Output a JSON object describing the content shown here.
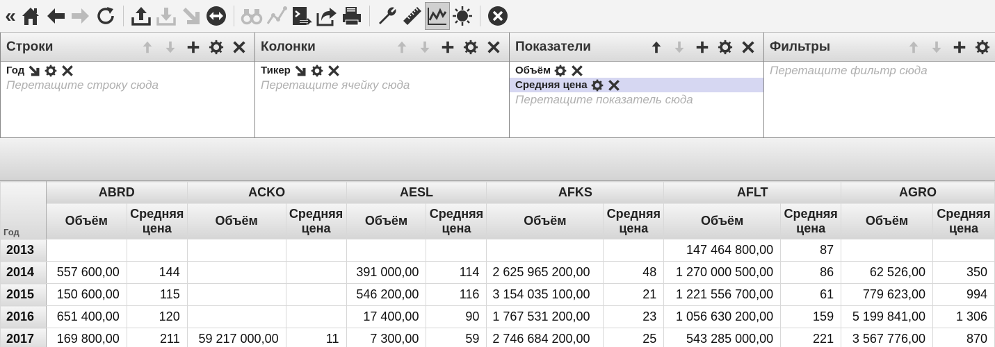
{
  "toolbar": {
    "collapse_glyph": "«",
    "icons": [
      "home-icon",
      "back-arrow-icon",
      "forward-arrow-icon",
      "refresh-icon",
      "upload-icon",
      "download-icon",
      "arrow-down-right-icon",
      "swap-icon",
      "binoculars-icon",
      "line-chart-icon",
      "export-image-icon",
      "share-icon",
      "print-icon",
      "wrench-icon",
      "ruler-icon",
      "chart-area-icon",
      "sun-icon",
      "close-circle-icon"
    ]
  },
  "panels": {
    "rows": {
      "title": "Строки",
      "chips": [
        {
          "label": "Год"
        }
      ],
      "hint": "Перетащите строку сюда"
    },
    "columns": {
      "title": "Колонки",
      "chips": [
        {
          "label": "Тикер"
        }
      ],
      "hint": "Перетащите ячейку сюда"
    },
    "measures": {
      "title": "Показатели",
      "chips": [
        {
          "label": "Объём"
        },
        {
          "label": "Средняя цена",
          "selected": true
        }
      ],
      "hint": "Перетащите показатель сюда"
    },
    "filters": {
      "title": "Фильтры",
      "hint": "Перетащите фильтр сюда"
    }
  },
  "grid": {
    "corner_label": "Год",
    "tickers": [
      "ABRD",
      "ACKO",
      "AESL",
      "AFKS",
      "AFLT",
      "AGRO"
    ],
    "measure_labels": {
      "volume": "Объём",
      "avg_price_line1": "Средняя",
      "avg_price_line2": "цена"
    },
    "rows": [
      {
        "year": "2013",
        "cells": [
          "",
          "",
          "",
          "",
          "",
          "",
          "",
          "",
          "147 464 800,00",
          "87",
          "",
          ""
        ]
      },
      {
        "year": "2014",
        "cells": [
          "557 600,00",
          "144",
          "",
          "",
          "391 000,00",
          "114",
          "2 625 965 200,00",
          "48",
          "1 270 000 500,00",
          "86",
          "62 526,00",
          "350"
        ]
      },
      {
        "year": "2015",
        "cells": [
          "150 600,00",
          "115",
          "",
          "",
          "546 200,00",
          "116",
          "3 154 035 100,00",
          "21",
          "1 221 556 700,00",
          "61",
          "779 623,00",
          "994"
        ]
      },
      {
        "year": "2016",
        "cells": [
          "651 400,00",
          "120",
          "",
          "",
          "17 400,00",
          "90",
          "1 767 531 200,00",
          "23",
          "1 056 630 200,00",
          "159",
          "5 199 841,00",
          "1 306"
        ]
      },
      {
        "year": "2017",
        "cells": [
          "169 800,00",
          "211",
          "59 217 000,00",
          "11",
          "7 300,00",
          "59",
          "2 746 684 200,00",
          "25",
          "543 285 000,00",
          "221",
          "3 567 776,00",
          "870"
        ]
      }
    ]
  }
}
